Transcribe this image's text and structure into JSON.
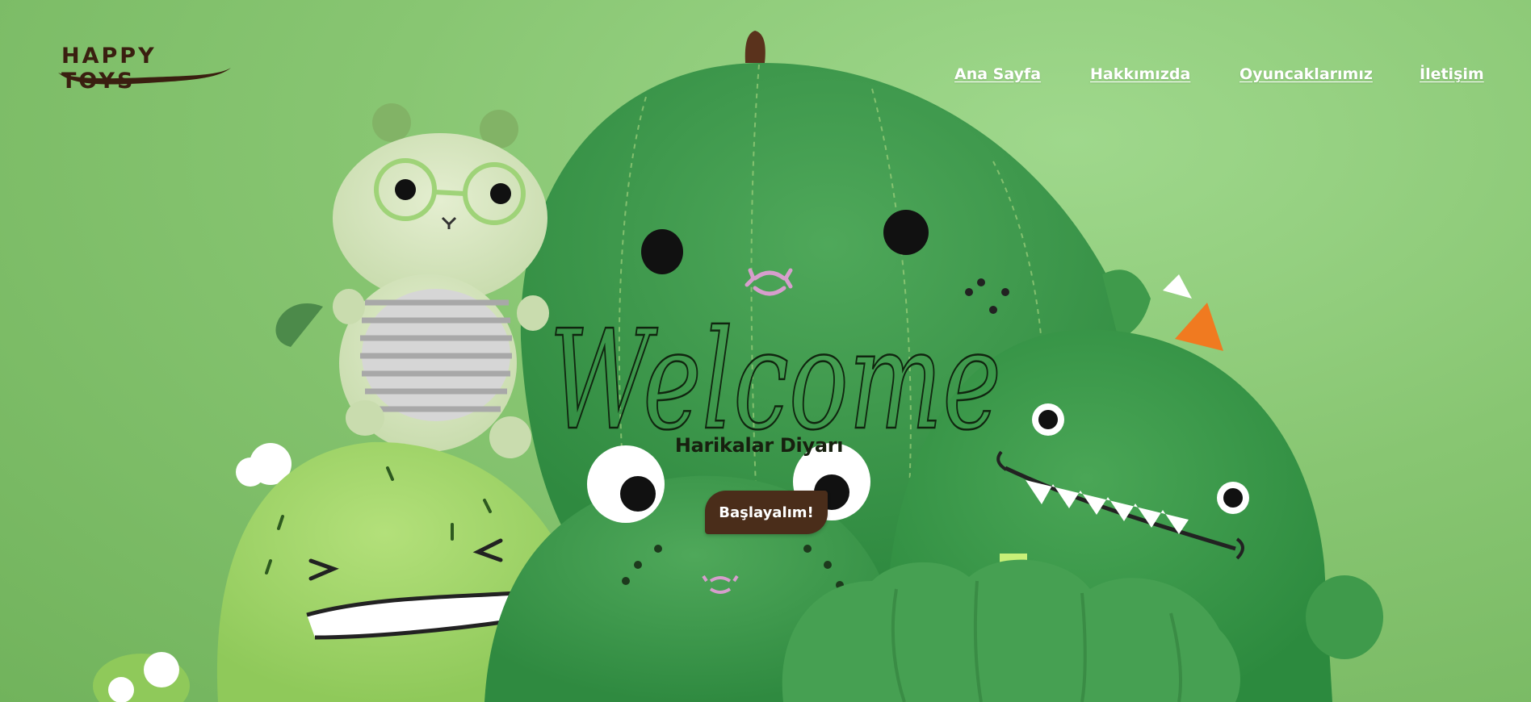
{
  "brand": {
    "name": "HAPPY TOYS",
    "text_color": "#3a1f10"
  },
  "nav": {
    "items": [
      {
        "label": "Ana Sayfa"
      },
      {
        "label": "Hakkımızda"
      },
      {
        "label": "Oyuncaklarımız"
      },
      {
        "label": "İletişim"
      }
    ],
    "color": "#ffffff"
  },
  "hero": {
    "script_title": "Welcome",
    "subtitle": "Harikalar Diyarı",
    "cta_label": "Başlayalım!",
    "cta_color": "#4a2d1a",
    "background_color": "#8dc978"
  }
}
